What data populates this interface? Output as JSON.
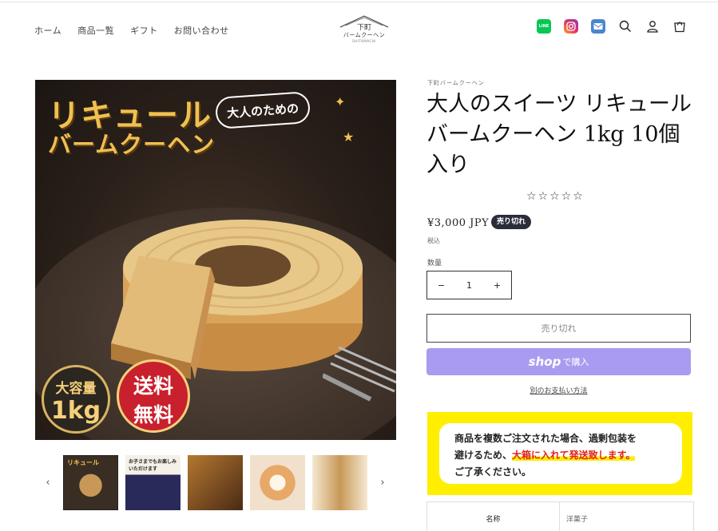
{
  "nav": {
    "items": [
      "ホーム",
      "商品一覧",
      "ギフト",
      "お問い合わせ"
    ]
  },
  "logo": {
    "line1": "下町",
    "line2": "バームクーヘン",
    "line3": "SHITAMACHI"
  },
  "header_icons": [
    "line-icon",
    "instagram-icon",
    "mail-icon",
    "search-icon",
    "account-icon",
    "cart-icon"
  ],
  "header_icon_text": {
    "line": "LINE"
  },
  "hero": {
    "headline_1": "リキュール",
    "headline_2": "バームクーヘン",
    "bubble": "大人のための",
    "badge_capacity_1": "大容量",
    "badge_capacity_2": "1kg",
    "badge_shipping_1": "送料",
    "badge_shipping_2": "無料"
  },
  "thumbs": {
    "items": [
      {
        "label": "リキュール",
        "selected": true
      },
      {
        "label": "お子さまでもお楽しみいただけます",
        "selected": false
      },
      {
        "label": "",
        "selected": false
      },
      {
        "label": "",
        "selected": false
      },
      {
        "label": "",
        "selected": false
      }
    ],
    "prev": "‹",
    "next": "›"
  },
  "product": {
    "vendor": "下町バームクーヘン",
    "title": "大人のスイーツ リキュールバームクーヘン 1kg 10個入り",
    "rating_stars": "☆☆☆☆☆",
    "price": "¥3,000 JPY",
    "sold_out_badge": "売り切れ",
    "tax_note": "税込",
    "quantity_label": "数量",
    "quantity_value": "1",
    "qty_minus": "−",
    "qty_plus": "+",
    "sold_out_button": "売り切れ",
    "shop_pay_logo": "shop",
    "shop_pay_buy": "で購入",
    "other_payment": "別のお支払い方法"
  },
  "notice": {
    "line1": "商品を複数ご注文された場合、過剰包装を",
    "line2_a": "避けるため、",
    "line2_b": "大箱に入れて発送致します。",
    "line3": "ご了承ください。"
  },
  "spec_table": {
    "key": "名称",
    "value": "洋菓子"
  },
  "colors": {
    "shop_pay": "#a99cf0",
    "notice_bg": "#ffee00",
    "sold_badge": "#2b2d3a",
    "notice_red": "#e0201a"
  }
}
